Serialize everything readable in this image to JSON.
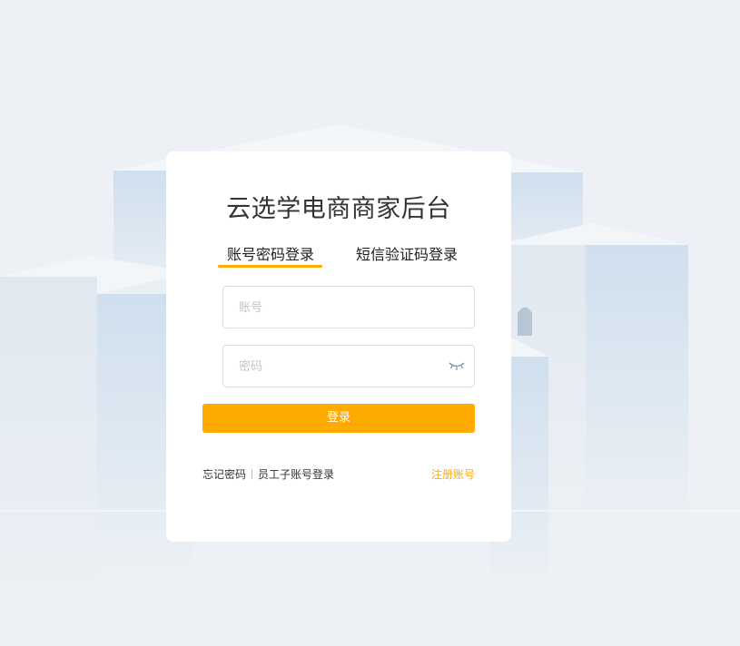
{
  "page": {
    "title": "云选学电商商家后台"
  },
  "tabs": [
    {
      "label": "账号密码登录",
      "active": true
    },
    {
      "label": "短信验证码登录",
      "active": false
    }
  ],
  "form": {
    "account": {
      "placeholder": "账号",
      "value": ""
    },
    "password": {
      "placeholder": "密码",
      "value": "",
      "toggle_icon": "eye-closed-icon"
    },
    "submit_label": "登录"
  },
  "footer": {
    "forgot_password": "忘记密码",
    "employee_login": "员工子账号登录",
    "register": "注册账号"
  },
  "colors": {
    "accent": "#ffaa00",
    "background": "#edf1f5",
    "card": "#ffffff",
    "building_light": "#dbe6f0",
    "building_dark": "#c5d7e8"
  }
}
